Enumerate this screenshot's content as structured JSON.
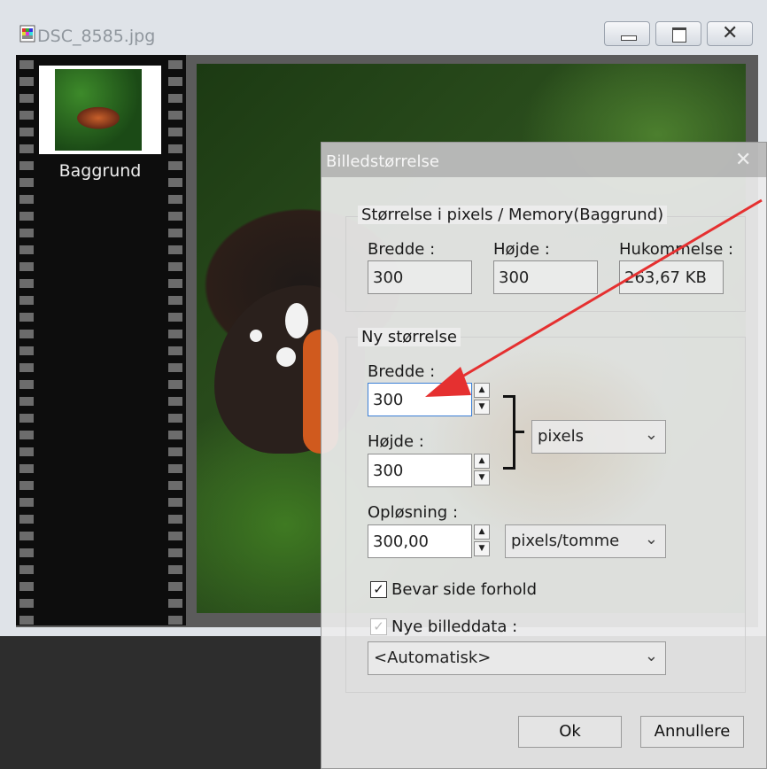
{
  "window": {
    "title": "DSC_8585.jpg",
    "colors": {
      "accent": "#3c7fd6",
      "arrow": "#e53030"
    }
  },
  "filmstrip": {
    "thumb_label": "Baggrund"
  },
  "dialog": {
    "title": "Billedstørrelse",
    "current": {
      "group_label": "Størrelse i pixels / Memory(Baggrund)",
      "width_label": "Bredde :",
      "width_value": "300",
      "height_label": "Højde :",
      "height_value": "300",
      "memory_label": "Hukommelse :",
      "memory_value": "263,67 KB"
    },
    "new_size": {
      "group_label": "Ny størrelse",
      "width_label": "Bredde :",
      "width_value": "300",
      "height_label": "Højde :",
      "height_value": "300",
      "unit_value": "pixels",
      "resolution_label": "Opløsning :",
      "resolution_value": "300,00",
      "resolution_unit": "pixels/tomme",
      "keep_ratio_label": "Bevar side forhold",
      "keep_ratio_checked": "✓",
      "new_data_label": "Nye billeddata :",
      "new_data_checked": "✓",
      "new_data_value": "<Automatisk>"
    },
    "ok_label": "Ok",
    "cancel_label": "Annullere"
  }
}
